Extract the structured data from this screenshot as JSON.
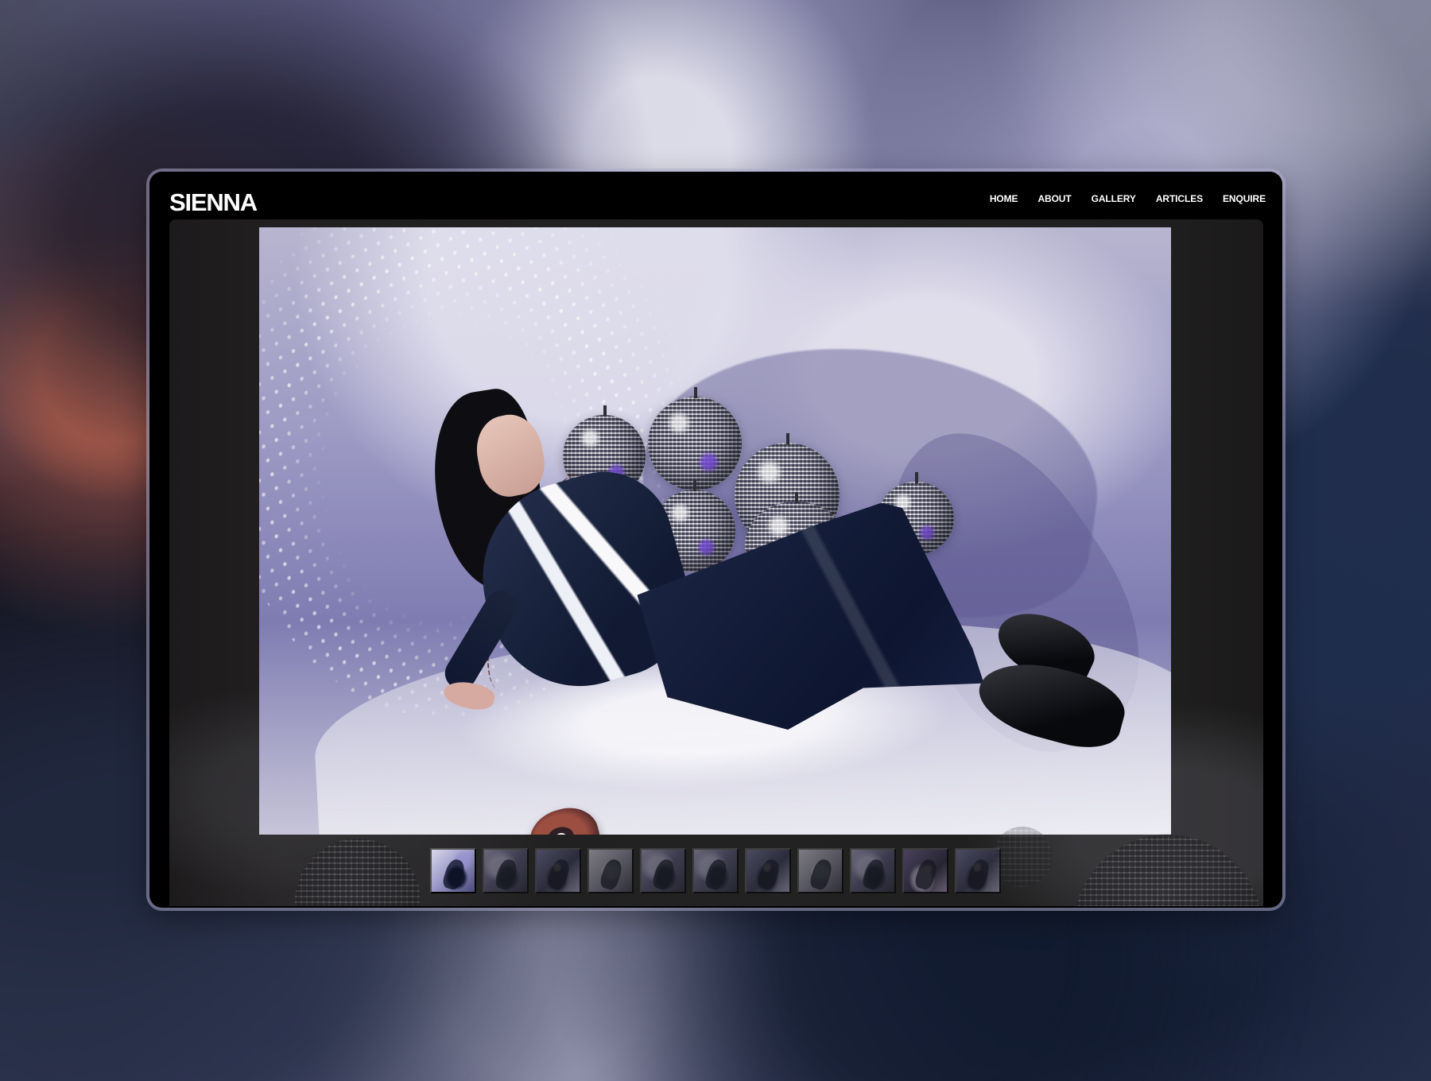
{
  "site": {
    "brand": "SIENNA"
  },
  "navigation": {
    "items": [
      {
        "label": "HOME"
      },
      {
        "label": "ABOUT"
      },
      {
        "label": "GALLERY"
      },
      {
        "label": "ARTICLES"
      },
      {
        "label": "ENQUIRE"
      }
    ]
  },
  "gallery": {
    "selected_index": 1,
    "thumbnail_count": 11,
    "thumbnails": [
      {
        "selected": true
      },
      {
        "selected": false
      },
      {
        "selected": false
      },
      {
        "selected": false
      },
      {
        "selected": false
      },
      {
        "selected": false
      },
      {
        "selected": false
      },
      {
        "selected": false
      },
      {
        "selected": false
      },
      {
        "selected": false
      },
      {
        "selected": false
      }
    ]
  },
  "colors": {
    "header_background": "#000000",
    "gallery_background": "#211f20",
    "accent_lavender": "#9d9ac4",
    "navy_clothing": "#111a32"
  }
}
